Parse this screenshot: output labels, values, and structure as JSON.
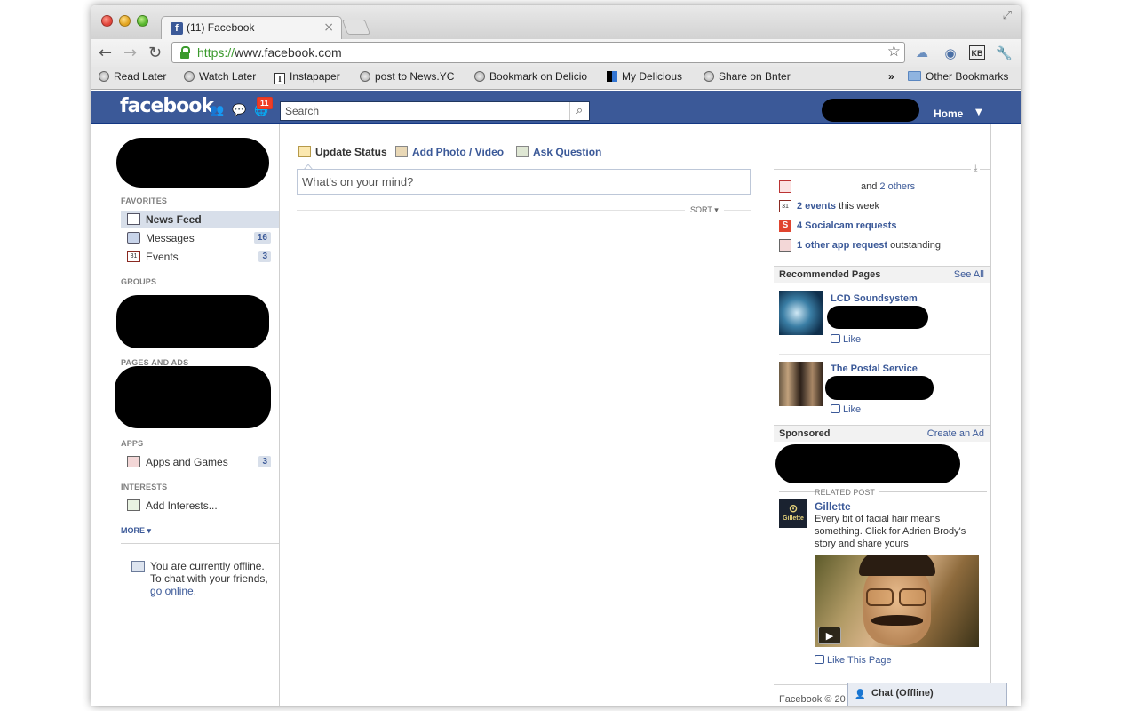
{
  "browser": {
    "tab_title": "(11) Facebook",
    "url_scheme": "https://",
    "url_rest": "www.facebook.com",
    "bookmarks": [
      {
        "label": "Read Later",
        "icon": "globe-icon"
      },
      {
        "label": "Watch Later",
        "icon": "globe-icon"
      },
      {
        "label": "Instapaper",
        "icon": "instapaper-icon"
      },
      {
        "label": "post to News.YC",
        "icon": "globe-icon"
      },
      {
        "label": "Bookmark on Delicio",
        "icon": "globe-icon"
      },
      {
        "label": "My Delicious",
        "icon": "delicious-icon"
      },
      {
        "label": "Share on Bnter",
        "icon": "globe-icon"
      }
    ],
    "overflow_label": "»",
    "other_bookmarks": "Other Bookmarks",
    "ext_kb_label": "KB"
  },
  "fb": {
    "logo": "facebook",
    "notification_count": "11",
    "search_placeholder": "Search",
    "home_label": "Home"
  },
  "left": {
    "favorites_head": "FAVORITES",
    "favorites": [
      {
        "label": "News Feed",
        "count": ""
      },
      {
        "label": "Messages",
        "count": "16"
      },
      {
        "label": "Events",
        "count": "3"
      }
    ],
    "groups_head": "GROUPS",
    "pages_head": "PAGES AND ADS",
    "apps_head": "APPS",
    "apps": [
      {
        "label": "Apps and Games",
        "count": "3"
      }
    ],
    "interests_head": "INTERESTS",
    "interests": [
      {
        "label": "Add Interests..."
      }
    ],
    "more_label": "MORE",
    "offline_text": "You are currently offline. To chat with your friends, ",
    "offline_link": "go online",
    "offline_end": "."
  },
  "center": {
    "tabs": [
      "Update Status",
      "Add Photo / Video",
      "Ask Question"
    ],
    "mind_placeholder": "What's on your mind?",
    "sort_label": "SORT"
  },
  "right": {
    "birthday_prefix": "and ",
    "birthday_link": "2 others",
    "events_link": "2 events",
    "events_suffix": " this week",
    "socialcam_link": "4 Socialcam requests",
    "apprequest_link": "1 other app request",
    "apprequest_suffix": " outstanding",
    "recommended_head": "Recommended Pages",
    "see_all": "See All",
    "pages": [
      {
        "name": "LCD Soundsystem",
        "like": "Like"
      },
      {
        "name": "The Postal Service",
        "like": "Like"
      }
    ],
    "sponsored_head": "Sponsored",
    "create_ad": "Create an Ad",
    "related_post": "RELATED POST",
    "ad_logo_text": "Gillette",
    "ad_title": "Gillette",
    "ad_text": "Every bit of facial hair means something. Click for Adrien Brody's story and share yours",
    "like_page": "Like This Page",
    "footer": "Facebook © 20"
  },
  "chat": {
    "label": "Chat (Offline)"
  },
  "colors": {
    "fb_blue": "#3b5998",
    "badge_red": "#f03d25",
    "selected_bg": "#d8dfea"
  }
}
